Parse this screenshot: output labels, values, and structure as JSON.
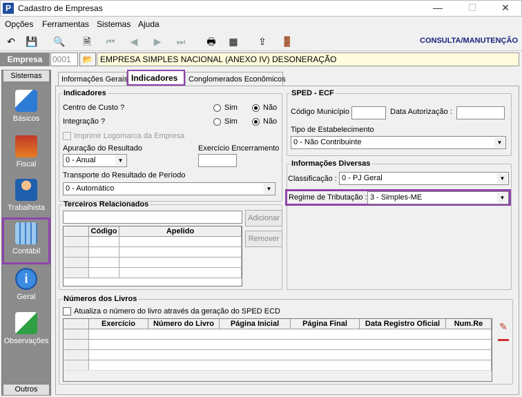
{
  "window": {
    "title": "Cadastro de Empresas",
    "icon_letter": "P",
    "minimize": "—",
    "maximize": "☐",
    "close": "✕"
  },
  "menu": [
    "Opções",
    "Ferramentas",
    "Sistemas",
    "Ajuda"
  ],
  "toolbar": {
    "mode": "CONSULTA/MANUTENÇÃO"
  },
  "empresa": {
    "label": "Empresa",
    "code": "0001",
    "name": "EMPRESA SIMPLES NACIONAL (ANEXO IV) DESONERAÇÃO"
  },
  "sidebar": {
    "header": "Sistemas",
    "footer": "Outros",
    "items": [
      "Básicos",
      "Fiscal",
      "Trabalhista",
      "Contábil",
      "Geral",
      "Observações"
    ]
  },
  "tabs": [
    "Informações Gerais",
    "Indicadores",
    "Conglomerados Econômicos"
  ],
  "indicadores": {
    "legend": "Indicadores",
    "centro_custo": {
      "label": "Centro de Custo ?",
      "sim": "Sim",
      "nao": "Não"
    },
    "integracao": {
      "label": "Integração ?",
      "sim": "Sim",
      "nao": "Não"
    },
    "imprimir_logo": "Imprimir Logomarca da Empresa",
    "apuracao": {
      "label": "Apuração do Resultado",
      "value": "0 - Anual"
    },
    "exercicio_encerramento": "Exercício Encerramento",
    "transporte": {
      "label": "Transporte do Resultado de Período",
      "value": "0 - Automático"
    }
  },
  "terceiros": {
    "legend": "Terceiros Relacionados",
    "columns": [
      "Código",
      "Apelido"
    ],
    "add": "Adicionar",
    "remove": "Remover"
  },
  "sped": {
    "legend": "SPED - ECF",
    "codigo_municipio": "Código Município :",
    "data_autorizacao": "Data Autorização :",
    "tipo_label": "Tipo de Estabelecimento",
    "tipo_value": "0 - Não Contribuinte"
  },
  "diversas": {
    "legend": "Informações Diversas",
    "classificacao_label": "Classificação :",
    "classificacao_value": "0 - PJ Geral",
    "regime_label": "Regime de Tributação :",
    "regime_value": "3 - Simples-ME"
  },
  "livros": {
    "legend": "Números dos Livros",
    "atualiza": "Atualiza o número do livro através da geração do SPED ECD",
    "columns": [
      "Exercício",
      "Número do Livro",
      "Página Inicial",
      "Página Final",
      "Data Registro Oficial",
      "Num.Re"
    ]
  },
  "colors": {
    "highlight": "#8e44ad",
    "sidebar": "#8c8c8c",
    "yellow_field": "#fffbdc"
  }
}
